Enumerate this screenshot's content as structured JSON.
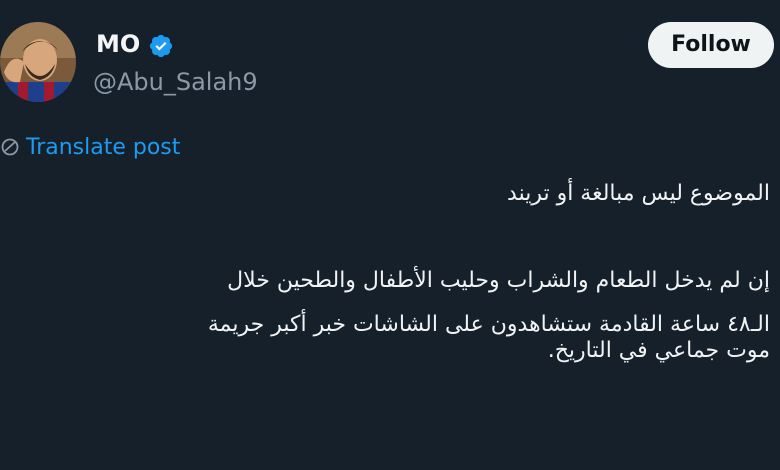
{
  "author": {
    "name": "MO",
    "handle": "@Abu_Salah9",
    "verified": true,
    "avatar_icon": "profile-photo"
  },
  "follow_button": {
    "label": "Follow"
  },
  "translate": {
    "label": "Translate post",
    "icon": "globe-icon"
  },
  "post": {
    "lines": [
      "الموضوع ليس مبالغة أو تريند",
      "إن لم يدخل الطعام والشراب وحليب الأطفال والطحين خلال",
      "الـ٤٨ ساعة القادمة ستشاهدون على الشاشات خبر أكبر جريمة",
      "موت جماعي في التاريخ."
    ]
  },
  "colors": {
    "background": "#15202b",
    "text": "#e7e9ea",
    "secondary_text": "#8b98a5",
    "link": "#1d9bf0",
    "follow_bg": "#eff3f4"
  }
}
